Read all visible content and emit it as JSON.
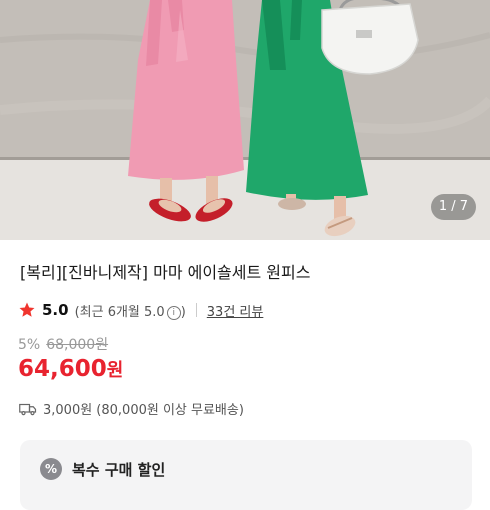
{
  "gallery": {
    "counter": "1 / 7"
  },
  "product": {
    "title": "[복리][진바니제작] 마마 에이숄세트 원피스",
    "rating": {
      "score": "5.0",
      "recent": "(최근 6개월 5.0",
      "recent_close": ")",
      "review_link": "33건 리뷰"
    },
    "discount_rate": "5%",
    "original_price": "68,000원",
    "price_amount": "64,600",
    "price_unit": "원"
  },
  "shipping": {
    "text": "3,000원 (80,000원 이상 무료배송)"
  },
  "promo": {
    "title": "복수 구매 할인",
    "subtitle": "",
    "icon_symbol": "%"
  },
  "colors": {
    "price_red": "#e8232f",
    "star_red": "#f0352e"
  },
  "icons": {
    "rating": "star-icon",
    "info": "info-icon",
    "shipping": "truck-icon",
    "promo": "percent-icon"
  }
}
